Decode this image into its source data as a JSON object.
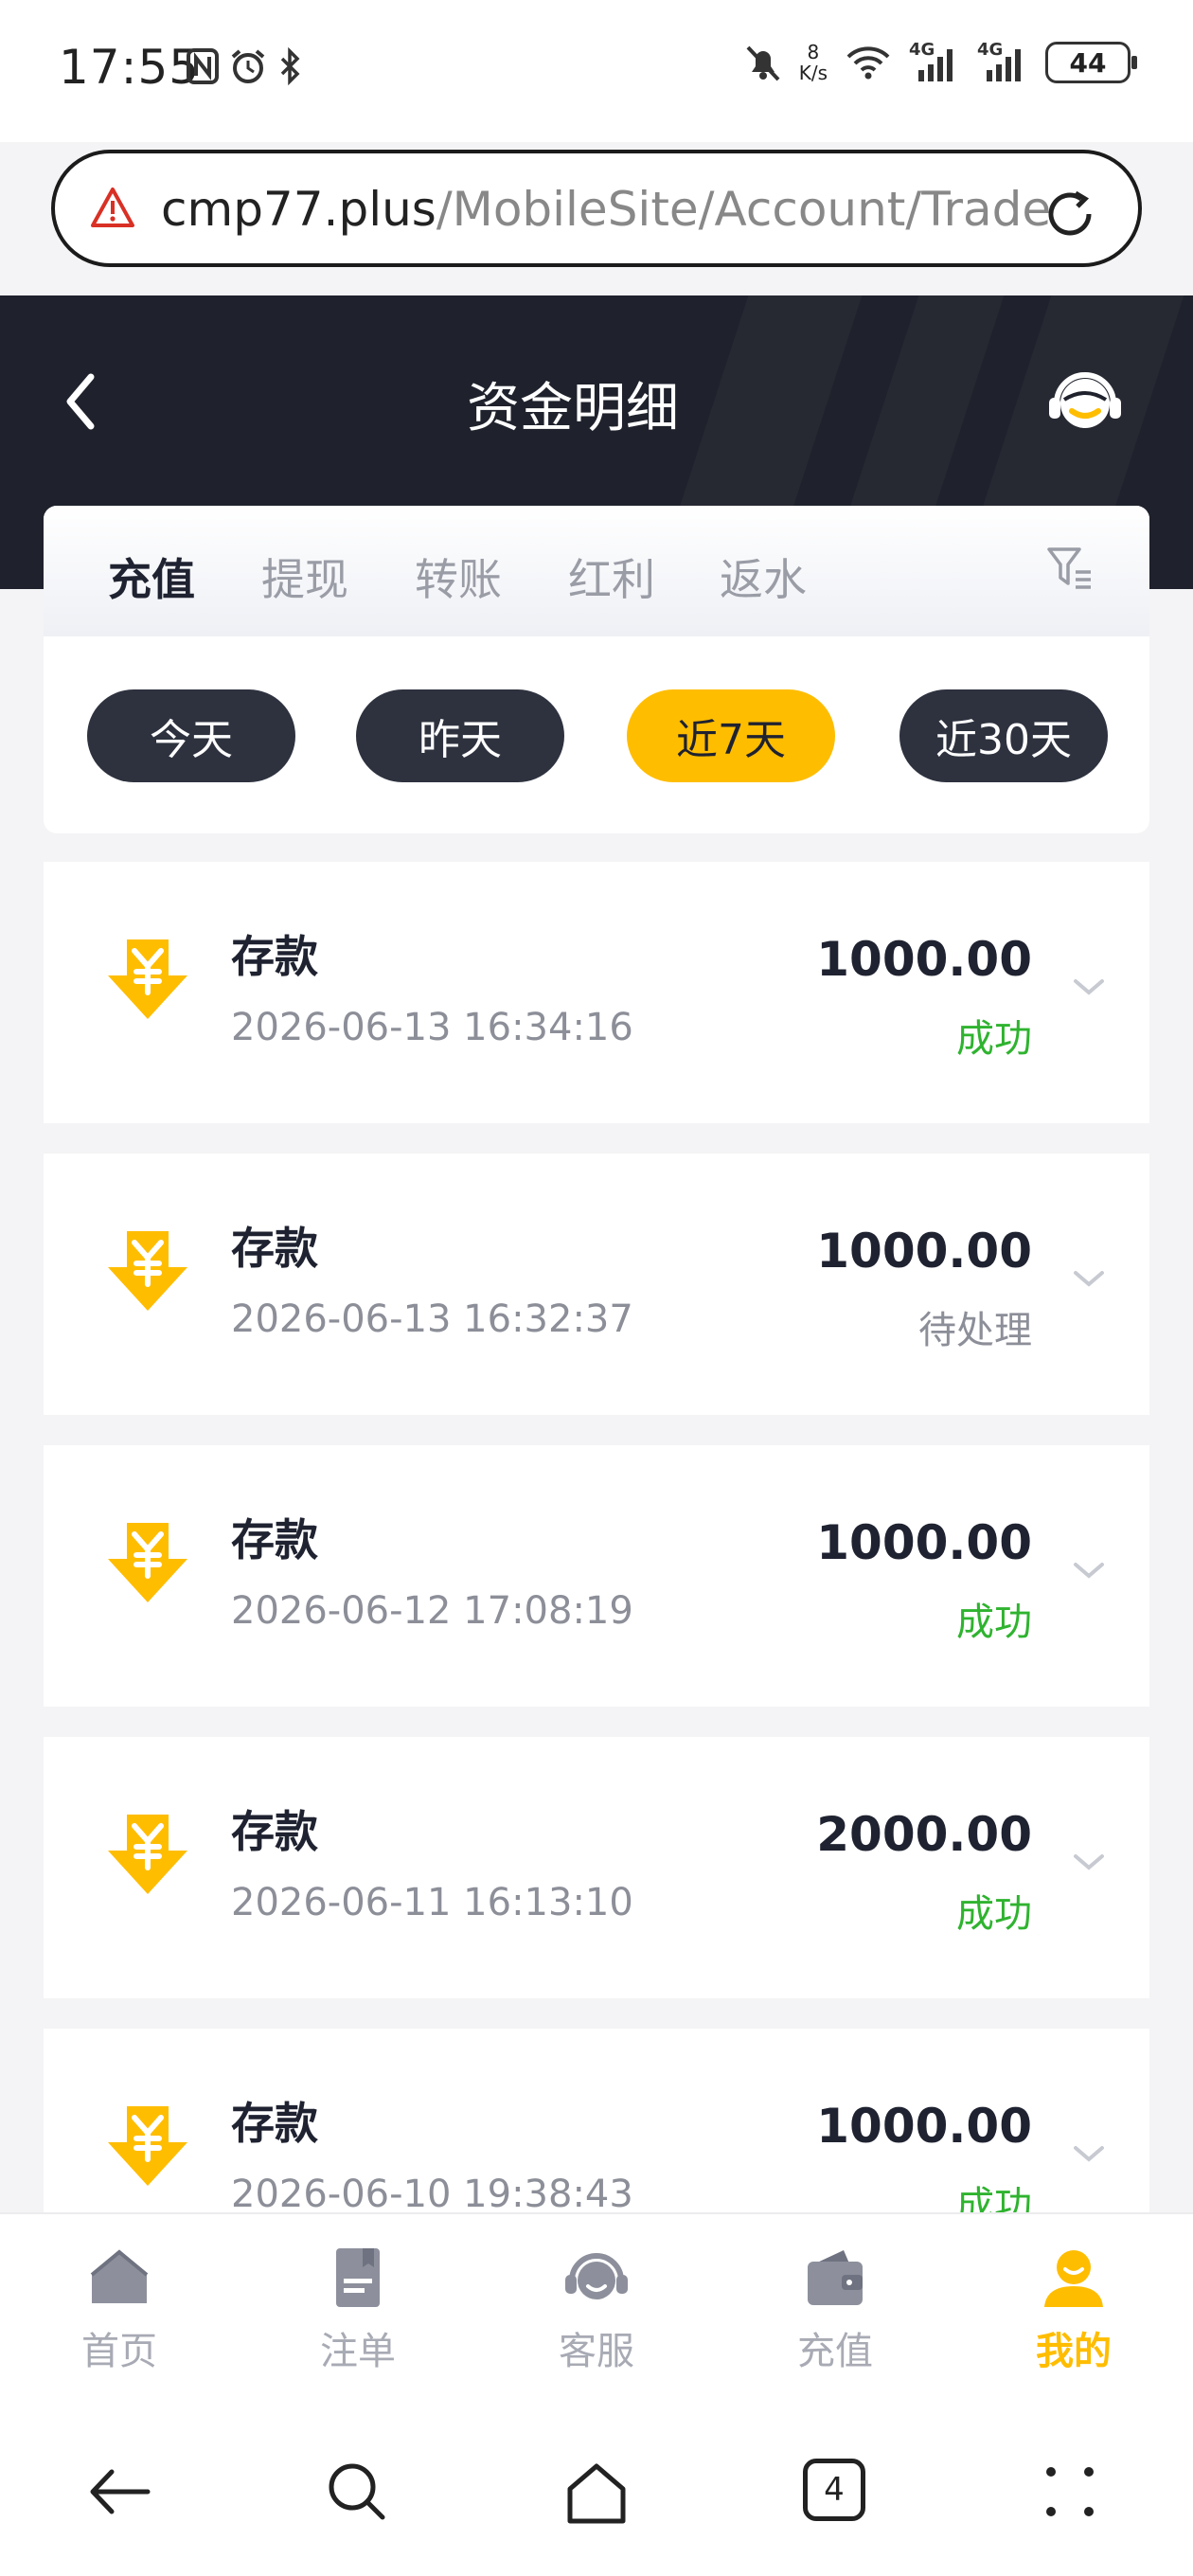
{
  "status_bar": {
    "time": "17:55",
    "net_speed_value": "8",
    "net_speed_unit": "K/s",
    "network_1": "4G",
    "network_2": "4G",
    "battery": "44"
  },
  "browser": {
    "url_host": "cmp77.plus",
    "url_path": "/MobileSite/Account/Trade"
  },
  "header": {
    "title": "资金明细"
  },
  "tabs": [
    {
      "label": "充值",
      "active": true
    },
    {
      "label": "提现",
      "active": false
    },
    {
      "label": "转账",
      "active": false
    },
    {
      "label": "红利",
      "active": false
    },
    {
      "label": "返水",
      "active": false
    }
  ],
  "ranges": [
    {
      "label": "今天",
      "active": false
    },
    {
      "label": "昨天",
      "active": false
    },
    {
      "label": "近7天",
      "active": true
    },
    {
      "label": "近30天",
      "active": false
    }
  ],
  "records": [
    {
      "type": "存款",
      "time": "2026-06-13 16:34:16",
      "amount": "1000.00",
      "status": "成功"
    },
    {
      "type": "存款",
      "time": "2026-06-13 16:32:37",
      "amount": "1000.00",
      "status": "待处理"
    },
    {
      "type": "存款",
      "time": "2026-06-12 17:08:19",
      "amount": "1000.00",
      "status": "成功"
    },
    {
      "type": "存款",
      "time": "2026-06-11 16:13:10",
      "amount": "2000.00",
      "status": "成功"
    },
    {
      "type": "存款",
      "time": "2026-06-10 19:38:43",
      "amount": "1000.00",
      "status": "成功"
    }
  ],
  "bottom_nav": [
    {
      "label": "首页",
      "icon": "home-icon",
      "active": false
    },
    {
      "label": "注单",
      "icon": "bet-slip-icon",
      "active": false
    },
    {
      "label": "客服",
      "icon": "customer-service-icon",
      "active": false
    },
    {
      "label": "充值",
      "icon": "wallet-icon",
      "active": false
    },
    {
      "label": "我的",
      "icon": "profile-icon",
      "active": true
    }
  ],
  "system_nav": {
    "tab_count": "4"
  },
  "colors": {
    "accent": "#ffbd00",
    "header_bg": "#1f222c",
    "success": "#2fb32f",
    "pending": "#8c8e98"
  }
}
